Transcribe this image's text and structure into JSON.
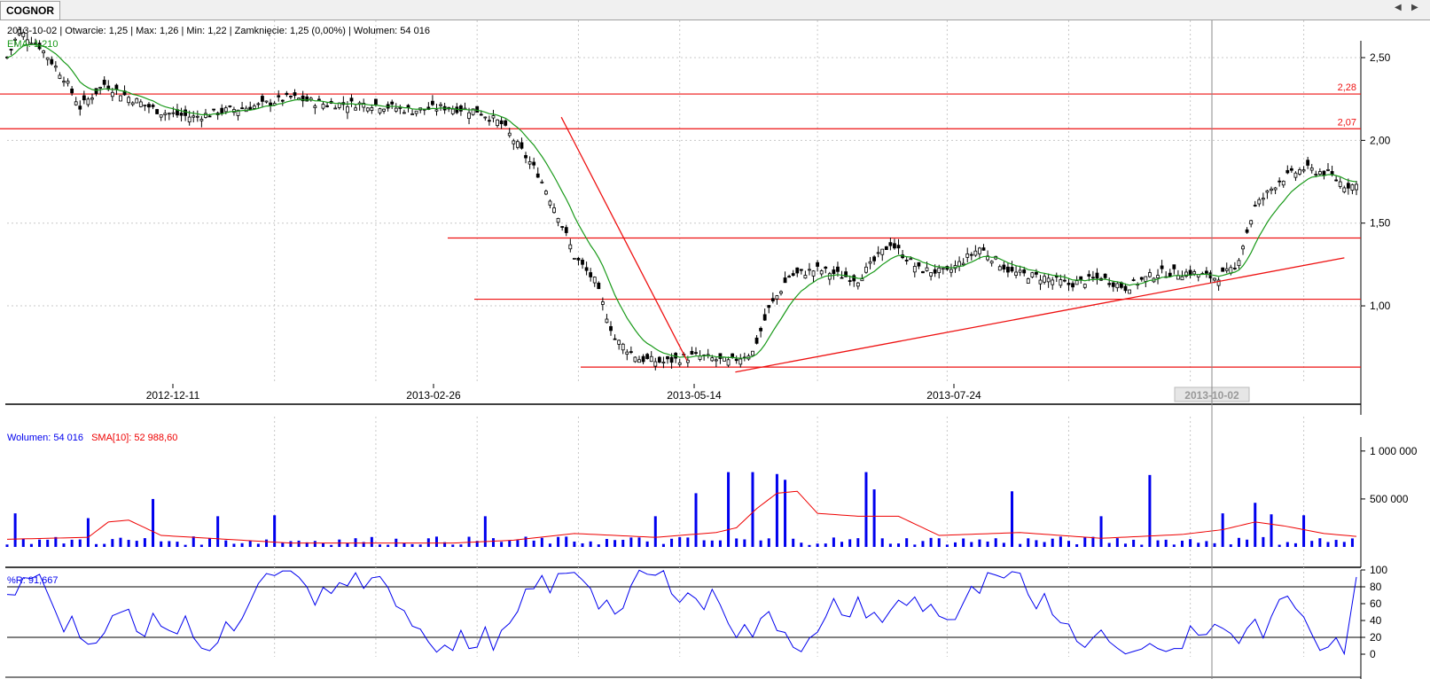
{
  "tab": {
    "label": "COGNOR"
  },
  "info": {
    "text": "2013-10-02 | Otwarcie: 1,25 | Max: 1,26 | Min: 1,22 | Zamknięcie: 1,25 (0,00%)  | Wolumen: 54 016",
    "ema": "EMA: 1,210"
  },
  "volume_legend": {
    "volume": "Wolumen: 54 016",
    "sma": "SMA[10]: 52 988,60"
  },
  "wr_legend": {
    "label": "%R: 91,667"
  },
  "colors": {
    "candle": "#000000",
    "ema": "#1a9a1a",
    "hline": "#ee1111",
    "volume": "#0000ee",
    "sma": "#ee0000",
    "wr": "#0000ee",
    "grid": "#c8c8c8"
  },
  "icons": {
    "left": "triangle-left-icon",
    "right": "triangle-right-icon"
  },
  "chart_data": {
    "type": "candlestick",
    "ticker": "COGNOR",
    "price_axis": {
      "ticks": [
        "2,50",
        "2,00",
        "1,50",
        "1,00"
      ],
      "range": [
        0.6,
        2.8
      ]
    },
    "date_labels": [
      "2012-12-11",
      "2013-02-26",
      "2013-05-14",
      "2013-07-24",
      "2013-10-02"
    ],
    "horizontal_levels": [
      {
        "value": 2.28,
        "label": "2,28"
      },
      {
        "value": 2.07,
        "label": "2,07"
      },
      {
        "value": 1.41,
        "label": ""
      },
      {
        "value": 1.04,
        "label": ""
      },
      {
        "value": 0.63,
        "label": ""
      }
    ],
    "trendlines": [
      {
        "from": {
          "date": "2013-03-22",
          "price": 2.14
        },
        "to": {
          "date": "2013-04-30",
          "price": 0.67
        }
      },
      {
        "from": {
          "date": "2013-05-15",
          "price": 0.6
        },
        "to": {
          "date": "2013-11-20",
          "price": 1.29
        }
      }
    ],
    "price_path": [
      [
        0,
        2.5
      ],
      [
        3,
        2.66
      ],
      [
        8,
        2.57
      ],
      [
        14,
        2.38
      ],
      [
        18,
        2.2
      ],
      [
        24,
        2.34
      ],
      [
        30,
        2.26
      ],
      [
        38,
        2.17
      ],
      [
        46,
        2.14
      ],
      [
        54,
        2.18
      ],
      [
        62,
        2.21
      ],
      [
        70,
        2.26
      ],
      [
        78,
        2.22
      ],
      [
        90,
        2.22
      ],
      [
        100,
        2.18
      ],
      [
        108,
        2.2
      ],
      [
        116,
        2.18
      ],
      [
        122,
        2.1
      ],
      [
        126,
        1.97
      ],
      [
        131,
        1.8
      ],
      [
        136,
        1.55
      ],
      [
        140,
        1.3
      ],
      [
        145,
        1.15
      ],
      [
        150,
        0.8
      ],
      [
        156,
        0.68
      ],
      [
        162,
        0.66
      ],
      [
        170,
        0.7
      ],
      [
        178,
        0.66
      ],
      [
        184,
        0.72
      ],
      [
        188,
        0.98
      ],
      [
        193,
        1.18
      ],
      [
        200,
        1.22
      ],
      [
        210,
        1.16
      ],
      [
        218,
        1.38
      ],
      [
        225,
        1.22
      ],
      [
        232,
        1.2
      ],
      [
        240,
        1.35
      ],
      [
        248,
        1.2
      ],
      [
        256,
        1.17
      ],
      [
        262,
        1.13
      ],
      [
        270,
        1.17
      ],
      [
        276,
        1.11
      ],
      [
        284,
        1.2
      ],
      [
        292,
        1.2
      ],
      [
        298,
        1.17
      ],
      [
        303,
        1.22
      ],
      [
        308,
        1.6
      ],
      [
        314,
        1.76
      ],
      [
        320,
        1.83
      ],
      [
        326,
        1.8
      ],
      [
        330,
        1.73
      ],
      [
        333,
        1.73
      ]
    ],
    "ema_label": "EMA: 1,210",
    "volume_axis": {
      "ticks": [
        "1 000 000",
        "500 000"
      ],
      "range": [
        0,
        1200000
      ]
    },
    "volume_spikes": [
      [
        2,
        350000
      ],
      [
        5,
        350000
      ],
      [
        20,
        300000
      ],
      [
        23,
        560000
      ],
      [
        25,
        880000
      ],
      [
        36,
        500000
      ],
      [
        52,
        320000
      ],
      [
        66,
        330000
      ],
      [
        118,
        320000
      ],
      [
        133,
        320000
      ],
      [
        137,
        350000
      ],
      [
        145,
        350000
      ],
      [
        160,
        320000
      ],
      [
        165,
        320000
      ],
      [
        170,
        560000
      ],
      [
        178,
        780000
      ],
      [
        184,
        780000
      ],
      [
        187,
        1200000
      ],
      [
        190,
        760000
      ],
      [
        192,
        700000
      ],
      [
        195,
        900000
      ],
      [
        203,
        900000
      ],
      [
        212,
        780000
      ],
      [
        214,
        600000
      ],
      [
        248,
        580000
      ],
      [
        270,
        320000
      ],
      [
        282,
        750000
      ],
      [
        300,
        350000
      ],
      [
        305,
        470000
      ],
      [
        308,
        460000
      ],
      [
        312,
        340000
      ],
      [
        320,
        330000
      ]
    ],
    "sma_path": [
      [
        0,
        80000
      ],
      [
        20,
        100000
      ],
      [
        25,
        260000
      ],
      [
        30,
        280000
      ],
      [
        38,
        120000
      ],
      [
        50,
        90000
      ],
      [
        70,
        40000
      ],
      [
        110,
        40000
      ],
      [
        125,
        70000
      ],
      [
        140,
        140000
      ],
      [
        160,
        100000
      ],
      [
        175,
        150000
      ],
      [
        180,
        200000
      ],
      [
        185,
        400000
      ],
      [
        190,
        560000
      ],
      [
        195,
        580000
      ],
      [
        200,
        350000
      ],
      [
        210,
        320000
      ],
      [
        220,
        320000
      ],
      [
        230,
        120000
      ],
      [
        250,
        150000
      ],
      [
        270,
        90000
      ],
      [
        290,
        130000
      ],
      [
        300,
        180000
      ],
      [
        308,
        260000
      ],
      [
        315,
        220000
      ],
      [
        325,
        140000
      ],
      [
        333,
        110000
      ]
    ],
    "wr_axis": {
      "ticks": [
        "100",
        "80",
        "60",
        "40",
        "20",
        "0"
      ],
      "range": [
        0,
        100
      ]
    },
    "wr_levels": [
      80,
      20
    ],
    "wr_last": 91.667
  }
}
